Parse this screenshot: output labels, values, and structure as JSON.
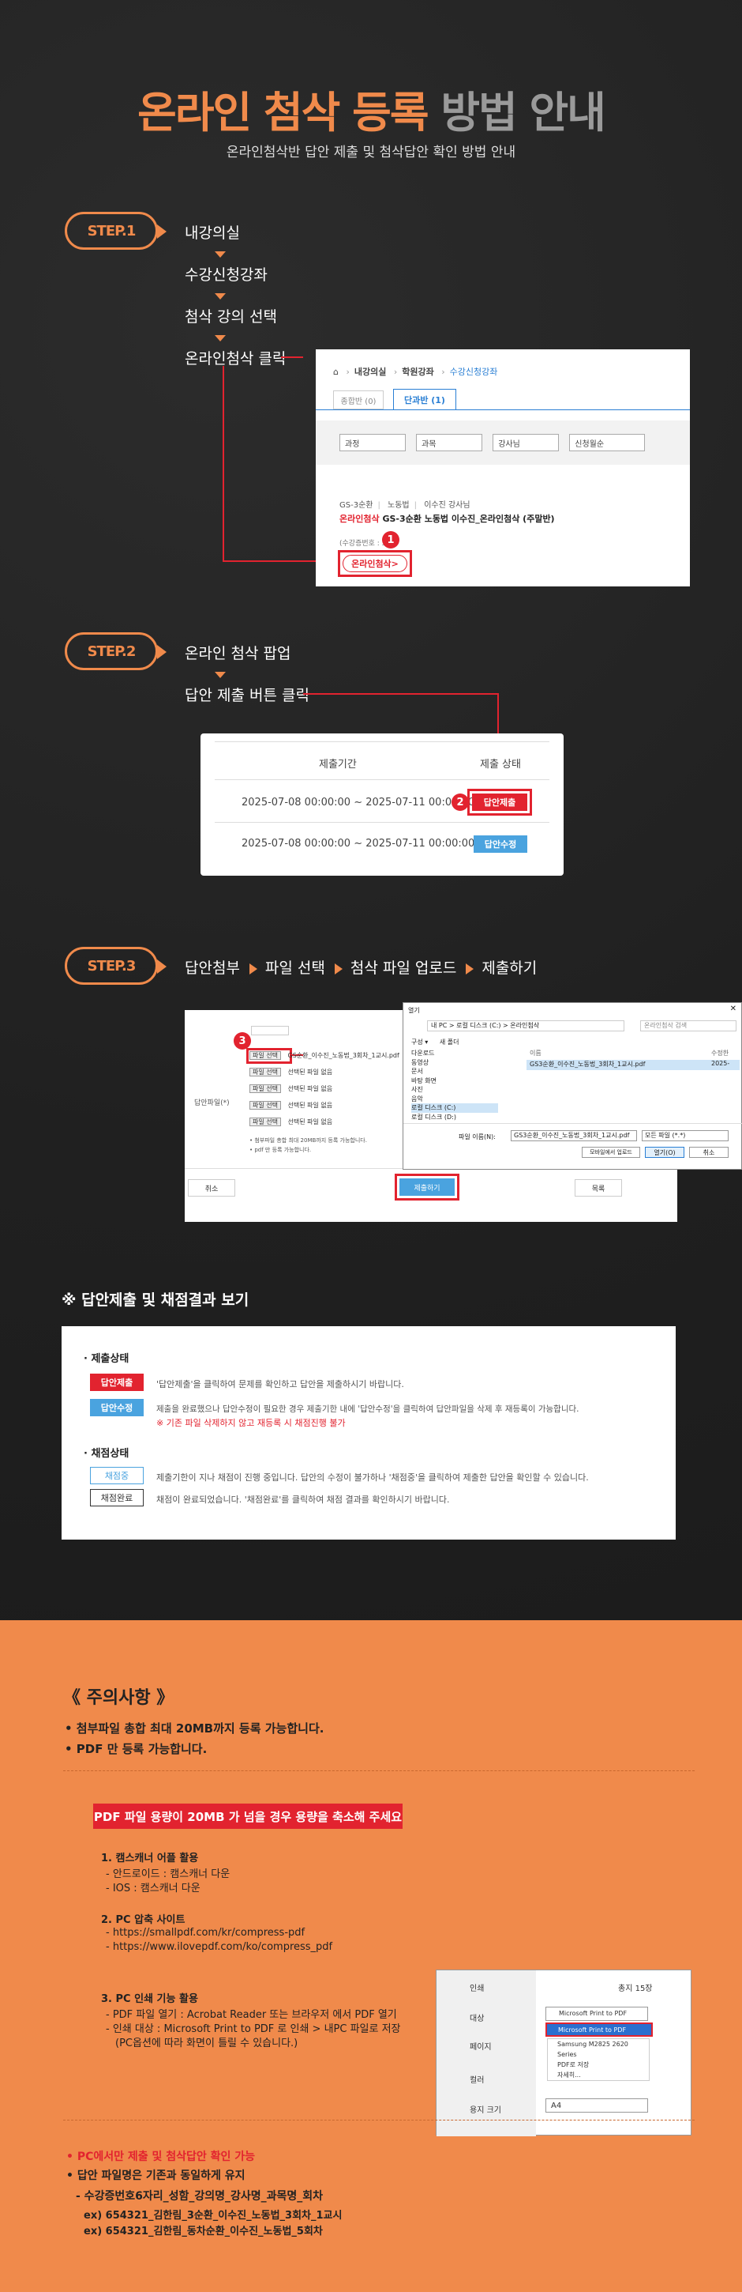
{
  "title": {
    "part1": "온라인 첨삭 등록",
    "part2": "방법 안내"
  },
  "subtitle": "온라인첨삭반 답안 제출 및 첨삭답안 확인 방법 안내",
  "step1": {
    "label": "STEP.1",
    "flow": [
      "내강의실",
      "수강신청강좌",
      "첨삭 강의 선택",
      "온라인첨삭 클릭"
    ],
    "shot": {
      "breadcrumb": [
        "내강의실",
        "학원강좌",
        "수강신청강좌"
      ],
      "tabs": [
        "종합반 (0)",
        "단과반 (1)"
      ],
      "filters": [
        "과정",
        "과목",
        "강사님",
        "신청월순"
      ],
      "course_meta": [
        "GS-3순환",
        "노동법",
        "이수진 강사님"
      ],
      "course_tag": "온라인첨삭",
      "course_title": "GS-3순환 노동법 이수진_온라인첨삭 (주말반)",
      "course_code": "(수강증번호 : 5",
      "online_button": "온라인첨삭>",
      "badge": "1"
    }
  },
  "step2": {
    "label": "STEP.2",
    "flow": [
      "온라인 첨삭 팝업",
      "답안 제출 버튼 클릭"
    ],
    "table": {
      "headers": [
        "제출기간",
        "제출 상태"
      ],
      "rows": [
        {
          "period": "2025-07-08 00:00:00 ~ 2025-07-11 00:00:00",
          "button": "답안제출"
        },
        {
          "period": "2025-07-08 00:00:00 ~ 2025-07-11 00:00:00",
          "button": "답안수정"
        }
      ],
      "badge": "2"
    }
  },
  "step3": {
    "label": "STEP.3",
    "flow": [
      "답안첨부",
      "파일 선택",
      "첨삭 파일 업로드",
      "제출하기"
    ],
    "form": {
      "field_label": "답안파일(*)",
      "file_button": "파일 선택",
      "rows": [
        "GS순환_이수진_노동법_3회차_1교시.pdf",
        "선택된 파일 없음",
        "선택된 파일 없음",
        "선택된 파일 없음",
        "선택된 파일 없음"
      ],
      "notes": [
        "• 첨부파일 총합 최대 20MB까지 등록 가능합니다.",
        "• pdf 만 등록 가능합니다."
      ],
      "cancel": "취소",
      "submit": "제출하기",
      "list": "목록",
      "badge": "3"
    },
    "dialog": {
      "title": "열기",
      "path": "내 PC  >  로컬 디스크 (C:)  >  온라인첨삭",
      "search": "온라인첨삭 검색",
      "toolbar": [
        "구성 ▾",
        "새 폴더"
      ],
      "tree": [
        "다운로드",
        "동영상",
        "문서",
        "바탕 화면",
        "사진",
        "음악",
        "로컬 디스크 (C:)",
        "로컬 디스크 (D:)"
      ],
      "col_name": "이름",
      "col_mod": "수정한",
      "file": "GS3순환_이수진_노동법_3회차_1교시.pdf",
      "file_date": "2025-",
      "filename_label": "파일 이름(N):",
      "filename_value": "GS3순환_이수진_노동법_3회차_1교시.pdf",
      "filter": "모든 파일 (*.*)",
      "upload_btn": "모바일에서 업로드",
      "open_btn": "열기(O)",
      "cancel_btn": "취소"
    }
  },
  "legend": {
    "heading": "※ 답안제출 및 채점결과 보기",
    "status_title": "· 제출상태",
    "items": [
      {
        "tag": "답안제출",
        "desc": "'답안제출'을 클릭하여 문제를 확인하고 답안을 제출하시기 바랍니다.",
        "color": "#e2232f"
      },
      {
        "tag": "답안수정",
        "desc": "제출을 완료했으나 답안수정이 필요한 경우 제출기한 내에 '답안수정'을 클릭하여 답안파일을 삭제 후 재등록이 가능합니다.",
        "note": "※ 기존 파일 삭제하지 않고 재등록 시 채점진행 불가",
        "color": "#4aa3df"
      }
    ],
    "grade_title": "· 채점상태",
    "grade_items": [
      {
        "tag": "채점중",
        "desc": "제출기한이 지나 채점이 진행 중입니다. 답안의 수정이 불가하나 '채점중'을 클릭하여 제출한 답안을 확인할 수 있습니다.",
        "color": "#4aa3df"
      },
      {
        "tag": "채점완료",
        "desc": "채점이 완료되었습니다. '채점완료'를 클릭하여 채점 결과를 확인하시기 바랍니다.",
        "color": "#333333"
      }
    ]
  },
  "notice": {
    "title": "《 주의사항 》",
    "bullets": [
      "• 첨부파일 총합 최대 20MB까지 등록 가능합니다.",
      "• PDF 만 등록 가능합니다."
    ],
    "banner": "PDF 파일 용량이 20MB 가 넘을 경우 용량을 축소해 주세요",
    "sec1": {
      "title": "1. 캠스캐너 어플 활용",
      "lines": [
        "- 안드로이드 : 캠스캐너 다운",
        "- IOS : 캠스캐너 다운"
      ]
    },
    "sec2": {
      "title": "2. PC 압축 사이트",
      "lines": [
        "- https://smallpdf.com/kr/compress-pdf",
        "- https://www.ilovepdf.com/ko/compress_pdf"
      ]
    },
    "sec3": {
      "title": "3. PC 인쇄 기능 활용",
      "lines": [
        "- PDF 파일 열기 : Acrobat Reader 또는 브라우저 에서 PDF 열기",
        "- 인쇄 대상 : Microsoft Print to PDF 로 인쇄 > 내PC 파일로 저장",
        "(PC옵션에 따라 화면이 틀릴 수 있습니다.)"
      ]
    },
    "print": {
      "rows": [
        "인쇄",
        "대상",
        "페이지",
        "컬러",
        "용지 크기"
      ],
      "pages": "총지 15장",
      "selected": "Microsoft Print to PDF",
      "options": [
        "Microsoft Print to PDF",
        "Samsung M2825 2620 Series",
        "PDF로 저장",
        "자세히..."
      ],
      "paper": "A4"
    },
    "footer": {
      "red": "• PC에서만 제출 및 첨삭답안 확인 가능",
      "rule": "• 답안 파일명은 기존과 동일하게 유지",
      "format": "- 수강증번호6자리_성함_강의명_강사명_과목명_회차",
      "ex1": "ex) 654321_김한림_3순환_이수진_노동법_3회차_1교시",
      "ex2": "ex) 654321_김한림_동차순환_이수진_노동법_5회차"
    }
  },
  "colors": {
    "accent": "#f08a4b",
    "red": "#e2232f",
    "blue": "#4aa3df"
  }
}
